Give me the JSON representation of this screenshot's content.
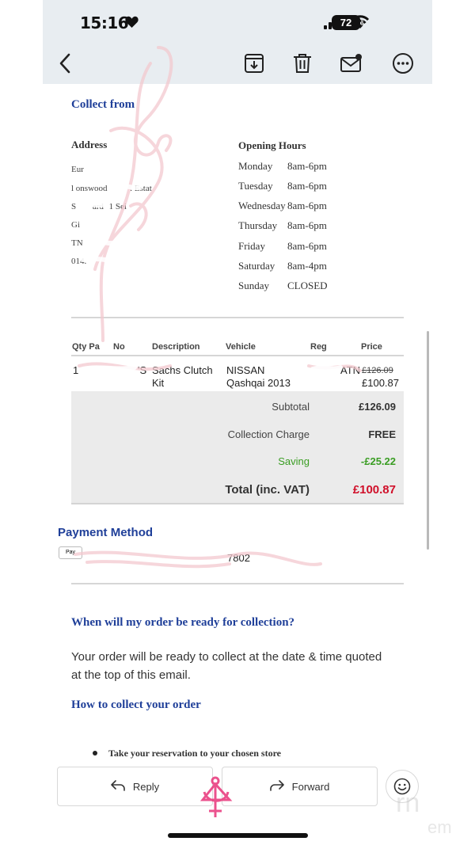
{
  "status_bar": {
    "time": "15:16",
    "battery": "72"
  },
  "toolbar": {
    "back_icon": "chevron-left-icon",
    "archive_icon": "archive-download-icon",
    "delete_icon": "trash-icon",
    "mark_icon": "mail-unread-icon",
    "more_icon": "ellipsis-circle-icon"
  },
  "collect": {
    "heading": "Collect from"
  },
  "address": {
    "label": "Address",
    "lines": [
      "Eur",
      "l onswood",
      ". Estat",
      "S",
      "ard",
      "1 Sei",
      "Gi",
      "TN",
      "014."
    ]
  },
  "hours": {
    "label": "Opening Hours",
    "rows": [
      {
        "day": "Monday",
        "time": "8am-6pm"
      },
      {
        "day": "Tuesday",
        "time": "8am-6pm"
      },
      {
        "day": "Wednesday",
        "time": "8am-6pm"
      },
      {
        "day": "Thursday",
        "time": "8am-6pm"
      },
      {
        "day": "Friday",
        "time": "8am-6pm"
      },
      {
        "day": "Saturday",
        "time": "8am-4pm"
      },
      {
        "day": "Sunday",
        "time": "CLOSED"
      }
    ]
  },
  "table": {
    "headers": {
      "qty_part": "Qty Pa",
      "no": "No",
      "description": "Description",
      "vehicle": "Vehicle",
      "reg": "Reg",
      "price": "Price"
    },
    "row": {
      "qty": "1",
      "part_tail": "'S",
      "description_1": "Sachs Clutch",
      "description_2": "Kit",
      "vehicle_1": "NISSAN",
      "vehicle_2": "Qashqai 2013",
      "reg_tail": "ATN",
      "old_price": "£126.09",
      "new_price": "£100.87"
    }
  },
  "summary": {
    "subtotal_label": "Subtotal",
    "subtotal": "£126.09",
    "collection_label": "Collection Charge",
    "collection": "FREE",
    "saving_label": "Saving",
    "saving": "-£25.22",
    "total_label": "Total (inc. VAT)",
    "total": "£100.87"
  },
  "payment": {
    "heading": "Payment Method",
    "card_tail": "7802",
    "wallet_badge": "Pay"
  },
  "faq": {
    "q1": "When will my order be ready for collection?",
    "a1": "Your order will be ready to collect at the date & time quoted at the top of this email.",
    "q2": "How to collect your order",
    "bullet1": "Take your reservation to your chosen store"
  },
  "actions": {
    "reply": "Reply",
    "forward": "Forward"
  },
  "colors": {
    "heading_blue": "#1f3f99",
    "saving_green": "#3a9d23",
    "total_red": "#d0102a",
    "header_bg": "#e8edf1"
  }
}
